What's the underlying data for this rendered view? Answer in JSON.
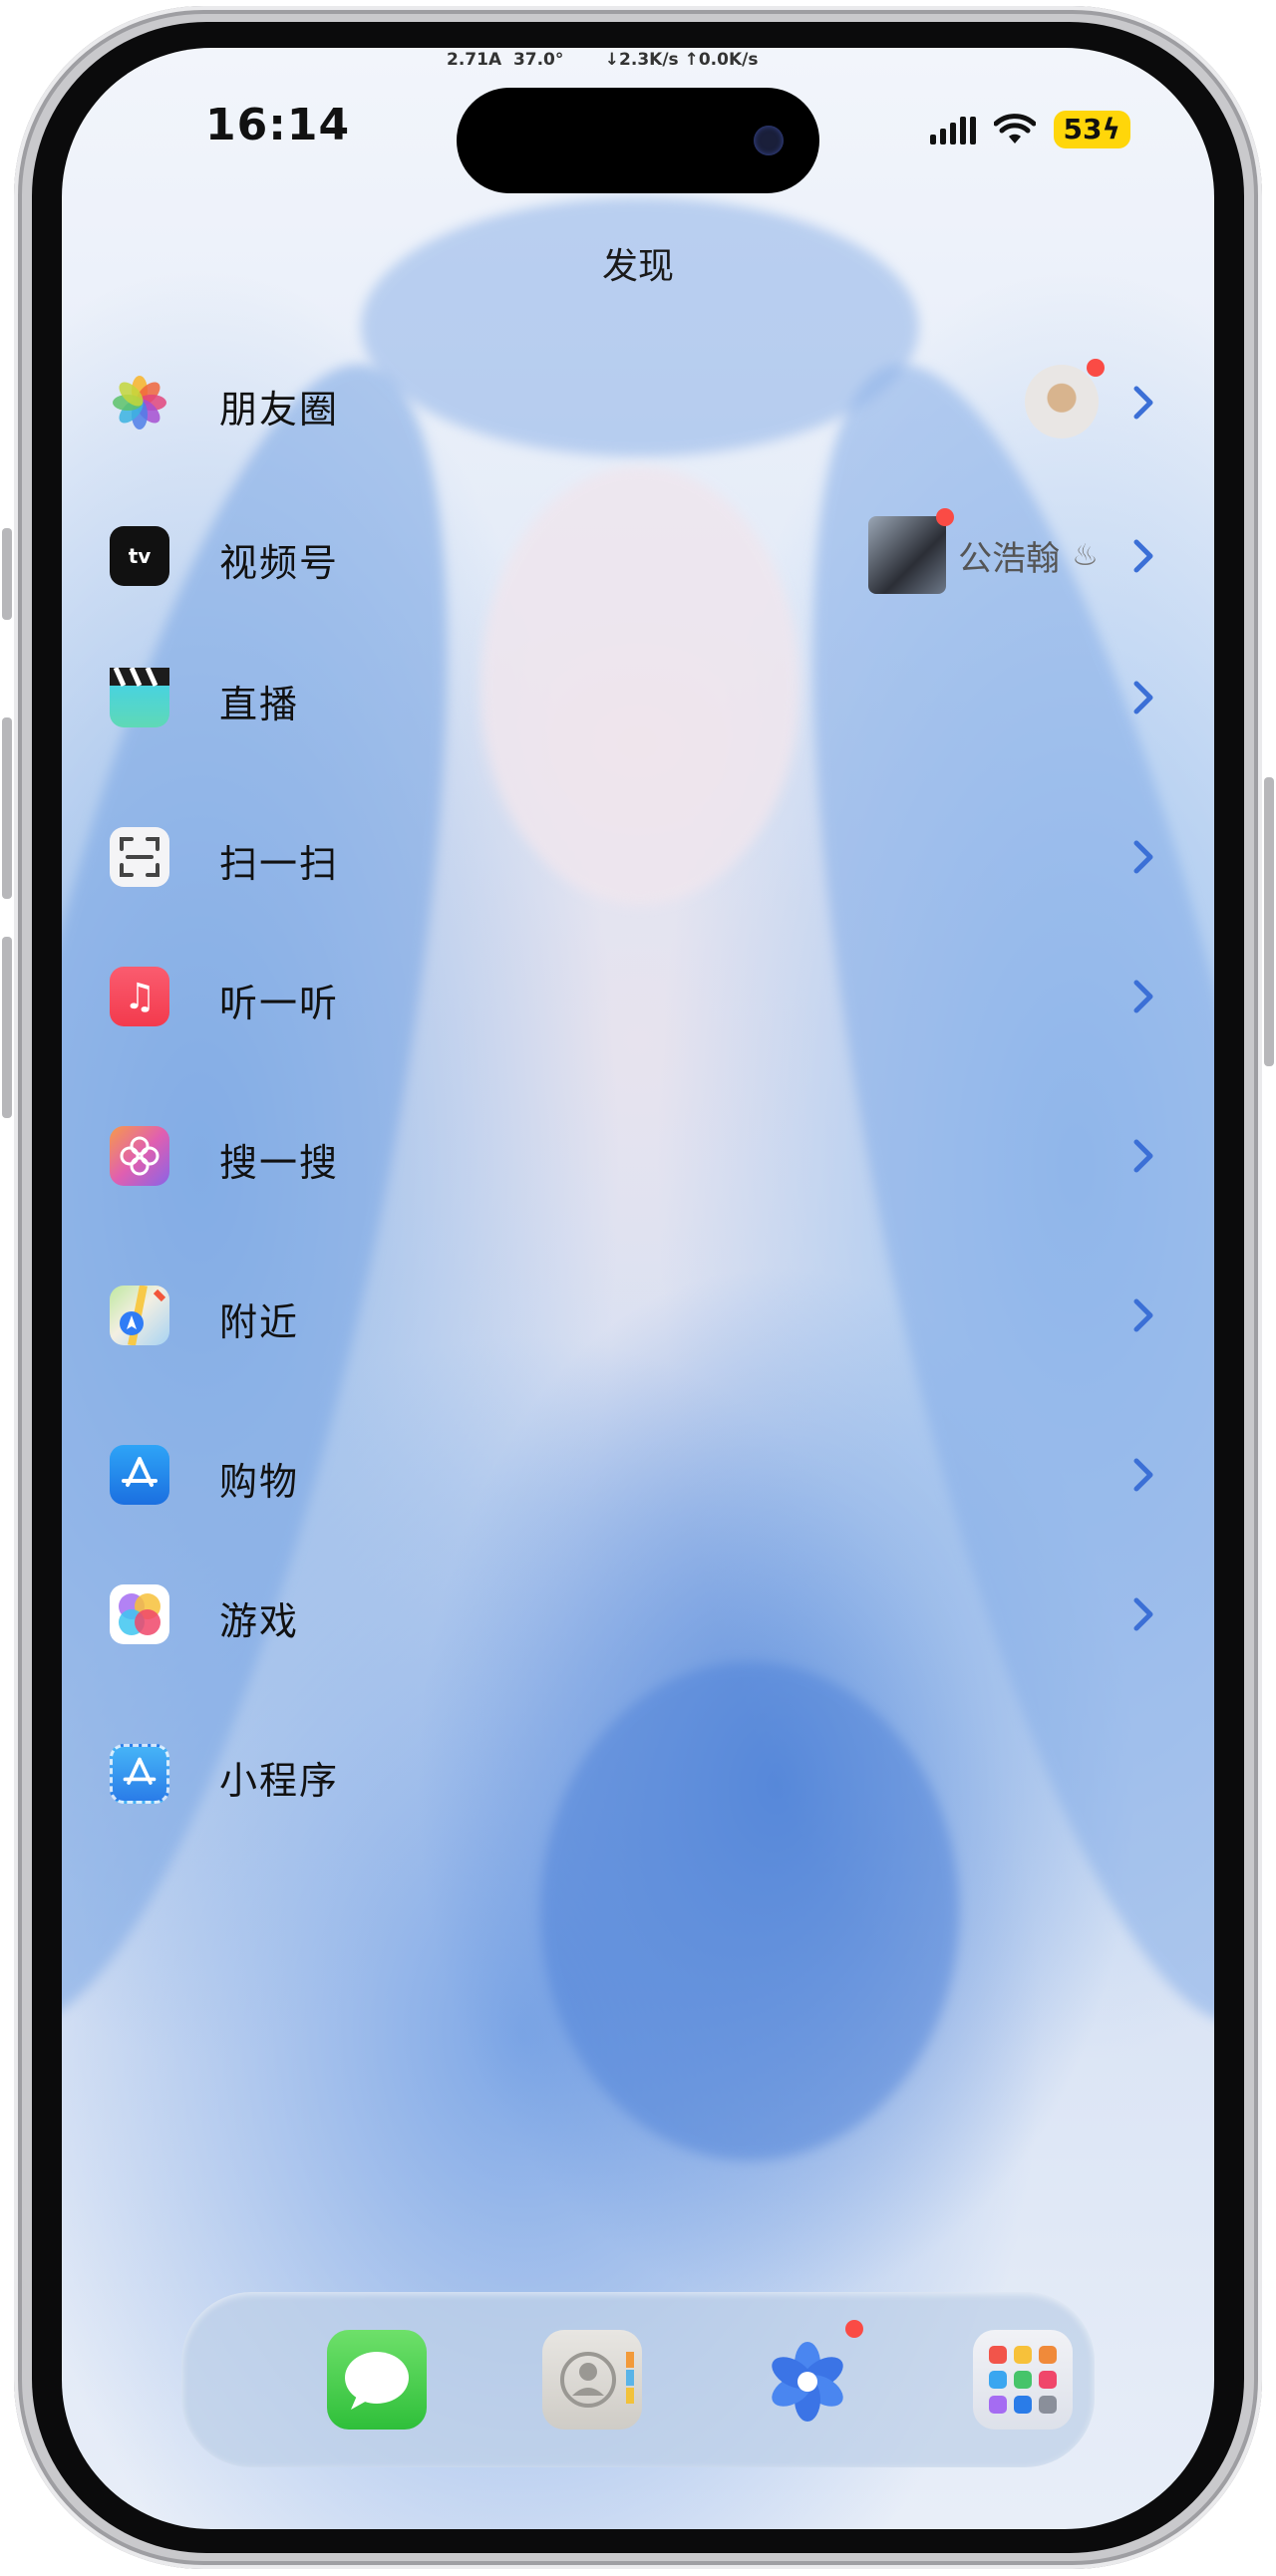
{
  "status_bar": {
    "time": "16:14",
    "net_readout": "2.71A  37.0°       ↓2.3K/s ↑0.0K/s",
    "battery": "53"
  },
  "page": {
    "title": "发现"
  },
  "menu": [
    {
      "label": "朋友圈",
      "icon": "photos-icon",
      "has_avatar_badge": true
    },
    {
      "label": "视频号",
      "icon": "apple-tv-icon",
      "sub_text": "公浩翰",
      "has_avatar_badge": true
    },
    {
      "label": "直播",
      "icon": "clapper-icon"
    },
    {
      "label": "扫一扫",
      "icon": "scan-icon"
    },
    {
      "label": "听一听",
      "icon": "music-icon"
    },
    {
      "label": "搜一搜",
      "icon": "search-flower-icon"
    },
    {
      "label": "附近",
      "icon": "maps-icon"
    },
    {
      "label": "购物",
      "icon": "app-store-icon"
    },
    {
      "label": "游戏",
      "icon": "game-center-icon"
    },
    {
      "label": "小程序",
      "icon": "mini-program-icon"
    }
  ],
  "dock": [
    "messages-icon",
    "contacts-icon",
    "flower-app-icon",
    "app-library-icon"
  ],
  "colors": {
    "chevron": "#3b6fd6",
    "accent_dot": "#fa4b45",
    "battery": "#ffd60a"
  }
}
